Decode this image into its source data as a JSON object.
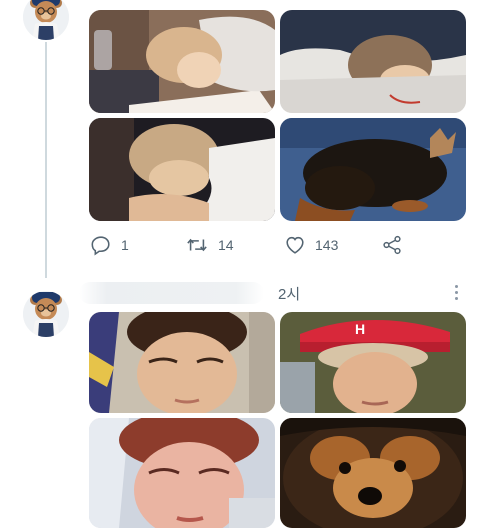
{
  "tweet1": {
    "actions": {
      "reply_count": "1",
      "retweet_count": "14",
      "like_count": "143"
    },
    "icons": [
      "reply-icon",
      "retweet-icon",
      "like-icon",
      "share-icon"
    ]
  },
  "tweet2": {
    "time": "2시",
    "icons": [
      "more-icon"
    ]
  },
  "colors": {
    "icon_gray": "#536471",
    "thread_line": "#cfd9de"
  }
}
